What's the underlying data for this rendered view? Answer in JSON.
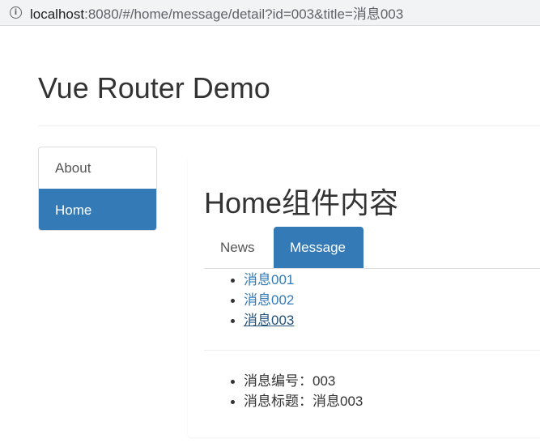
{
  "browser": {
    "url_host": "localhost",
    "url_rest": ":8080/#/home/message/detail?id=003&title=消息003"
  },
  "page": {
    "title": "Vue Router Demo"
  },
  "nav": {
    "items": [
      {
        "label": "About",
        "active": false
      },
      {
        "label": "Home",
        "active": true
      }
    ]
  },
  "home": {
    "heading": "Home组件内容",
    "tabs": [
      {
        "label": "News",
        "active": false
      },
      {
        "label": "Message",
        "active": true
      }
    ],
    "messages": [
      {
        "label": "消息001"
      },
      {
        "label": "消息002"
      },
      {
        "label": "消息003",
        "current": true
      }
    ],
    "detail": {
      "id_line": "消息编号：003",
      "title_line": "消息标题：消息003"
    }
  },
  "colors": {
    "accent": "#337ab7",
    "link": "#337ab7",
    "link_visited": "#23527c"
  }
}
